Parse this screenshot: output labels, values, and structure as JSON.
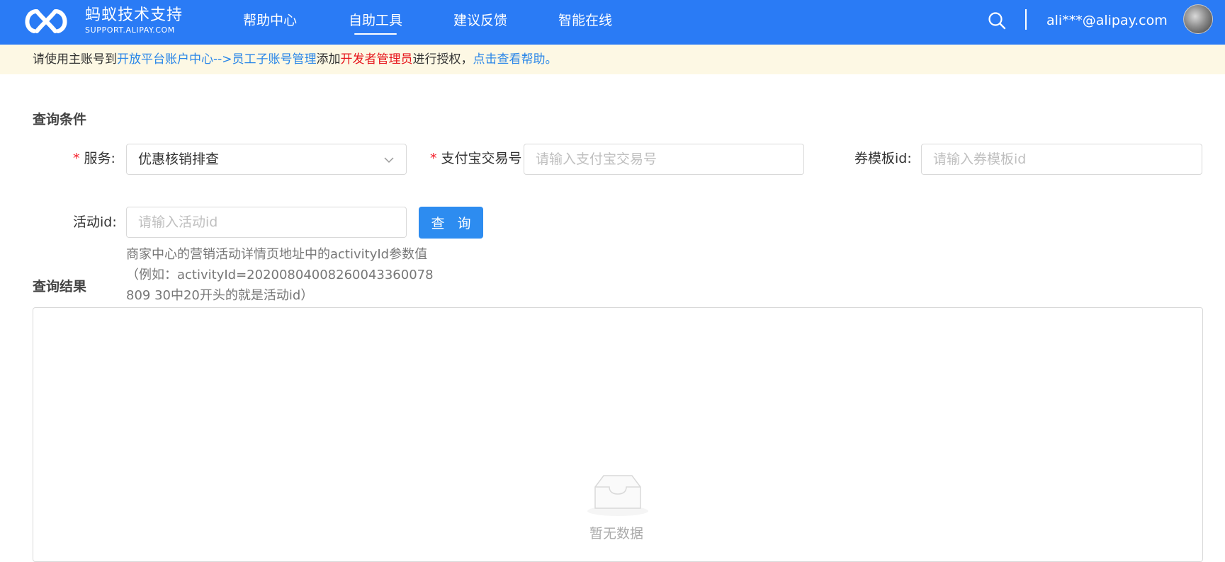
{
  "header": {
    "logo_cn": "蚂蚁技术支持",
    "logo_en": "SUPPORT.ALIPAY.COM",
    "nav": [
      {
        "label": "帮助中心"
      },
      {
        "label": "自助工具"
      },
      {
        "label": "建议反馈"
      },
      {
        "label": "智能在线"
      }
    ],
    "active_nav": "自助工具",
    "user_email": "ali***@alipay.com"
  },
  "notice": {
    "part1": "请使用主账号到",
    "link1": "开放平台账户中心-->员工子账号管理",
    "part2": "添加",
    "warn": "开发者管理员",
    "part3": "进行授权，",
    "link2": "点击查看帮助。"
  },
  "query": {
    "title": "查询条件",
    "service": {
      "label": "服务:",
      "value": "优惠核销排查"
    },
    "trade_no": {
      "label": "支付宝交易号",
      "placeholder": "请输入支付宝交易号"
    },
    "template_id": {
      "label": "券模板id:",
      "placeholder": "请输入券模板id"
    },
    "activity_id": {
      "label": "活动id:",
      "placeholder": "请输入活动id",
      "help": "商家中心的营销活动详情页地址中的activityId参数值（例如：activityId=20200804008260043360078809 30中20开头的就是活动id）"
    },
    "button_label": "查 询"
  },
  "result": {
    "title": "查询结果",
    "empty_text": "暂无数据"
  },
  "colors": {
    "brand": "#2a7bf5",
    "primary_button": "#2d8cf0",
    "link": "#2a86e8",
    "warn": "#e6161c",
    "required": "#f5222d",
    "notice_bg": "#fdf8e4"
  },
  "icons": {
    "logo": "alipay-loop-logo-icon",
    "search": "search-icon",
    "select_arrow": "chevron-down-icon",
    "empty": "empty-inbox-icon"
  }
}
